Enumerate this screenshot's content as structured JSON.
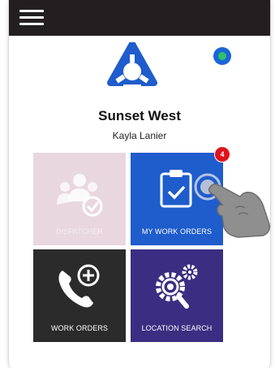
{
  "app": {
    "company_name": "Sunset West",
    "user_name": "Kayla Lanier"
  },
  "header": {
    "menu_icon": "hamburger-menu-icon",
    "background": "#231f20"
  },
  "status": {
    "icon": "clock-icon",
    "color": "#1a66d9"
  },
  "tiles": [
    {
      "label": "DISPATCHER",
      "icon": "users-check-icon",
      "color": "#e8d7df",
      "disabled": true
    },
    {
      "label": "MY WORK ORDERS",
      "icon": "clipboard-check-icon",
      "color": "#1f5ccc",
      "badge": "4"
    },
    {
      "label": "WORK ORDERS",
      "icon": "phone-plus-icon",
      "color": "#2b2b2b"
    },
    {
      "label": "LOCATION SEARCH",
      "icon": "gears-search-icon",
      "color": "#3b2e82"
    }
  ],
  "badge_color": "#e0121b",
  "logo_color": "#1f5ccc"
}
